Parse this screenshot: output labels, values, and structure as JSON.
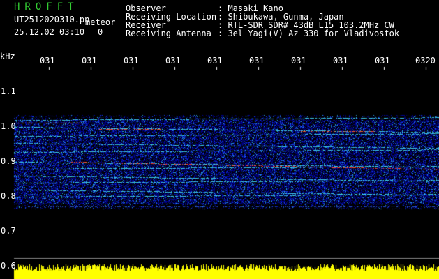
{
  "app": {
    "title": "HROFFT",
    "filename": "UT2512020310.pn",
    "subtitle": "meteor",
    "datetime": "25.12.02 03:10",
    "counter": "0"
  },
  "station_info": {
    "labels": [
      "Observer",
      "Receiving Location",
      "Receiver",
      "Receiving Antenna"
    ],
    "values": [
      ": Masaki Kano",
      ": Shibukawa, Gunma, Japan",
      ": RTL-SDR SDR# 43dB L15 103.2MHz CW",
      ": 3el Yagi(V) Az 330 for Vladivostok"
    ]
  },
  "y_axis": {
    "unit": "kHz",
    "ticks": [
      "1.1",
      "1.0",
      "0.9",
      "0.8",
      "0.7",
      "0.6"
    ]
  },
  "x_axis": {
    "ticks": [
      "031",
      "031",
      "031",
      "031",
      "031",
      "031",
      "031",
      "031",
      "031",
      "0320"
    ]
  },
  "colors": {
    "background": "#000000",
    "header_green": "#33cc33",
    "text": "#ffffff",
    "baseline_yellow": "#ffff00",
    "echo_red": "#ff3030",
    "noise_blue": "#1030c0"
  }
}
